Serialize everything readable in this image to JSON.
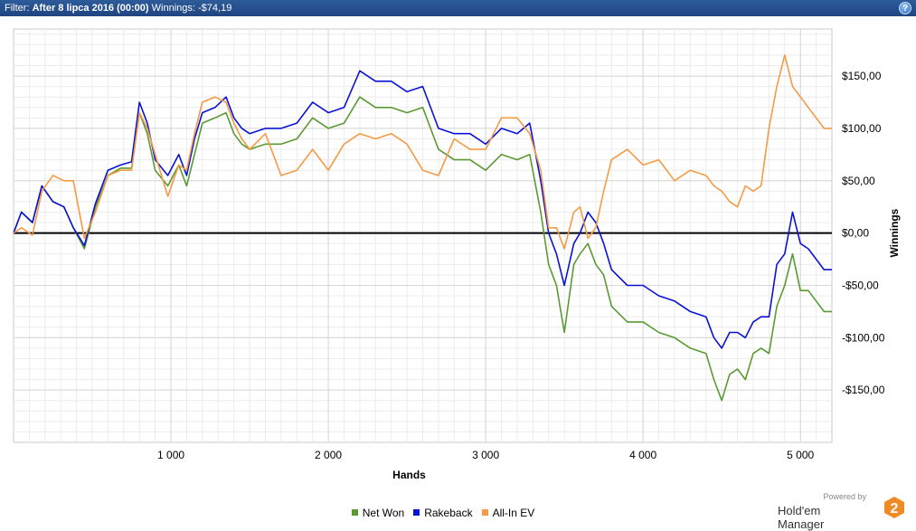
{
  "header": {
    "filter_label": "Filter:",
    "filter_value": "After 8 lipca 2016 (00:00)",
    "winnings_label": "Winnings:",
    "winnings_value": "-$74,19",
    "help_glyph": "?"
  },
  "brand": {
    "powered_by": "Powered by",
    "name": "Hold'em Manager",
    "logo_glyph": "2",
    "logo_color": "#f08a24"
  },
  "chart_data": {
    "type": "line",
    "xlabel": "Hands",
    "ylabel": "Winnings",
    "xlim": [
      0,
      5200
    ],
    "ylim": [
      -200,
      195
    ],
    "x_ticks": [
      1000,
      2000,
      3000,
      4000,
      5000
    ],
    "x_tick_labels": [
      "1 000",
      "2 000",
      "3 000",
      "4 000",
      "5 000"
    ],
    "y_ticks": [
      150,
      100,
      50,
      0,
      -50,
      -100,
      -150
    ],
    "y_tick_labels": [
      "$150,00",
      "$100,00",
      "$50,00",
      "$0,00",
      "-$50,00",
      "-$100,00",
      "-$150,00"
    ],
    "grid": true,
    "legend_position": "bottom-center",
    "series": [
      {
        "name": "Net Won",
        "color": "#5a9a32",
        "points": [
          [
            0,
            0
          ],
          [
            50,
            20
          ],
          [
            120,
            10
          ],
          [
            180,
            45
          ],
          [
            250,
            30
          ],
          [
            320,
            25
          ],
          [
            380,
            5
          ],
          [
            450,
            -15
          ],
          [
            520,
            25
          ],
          [
            600,
            55
          ],
          [
            680,
            62
          ],
          [
            750,
            62
          ],
          [
            800,
            115
          ],
          [
            850,
            95
          ],
          [
            900,
            60
          ],
          [
            980,
            45
          ],
          [
            1050,
            65
          ],
          [
            1100,
            45
          ],
          [
            1150,
            75
          ],
          [
            1200,
            105
          ],
          [
            1280,
            110
          ],
          [
            1350,
            115
          ],
          [
            1400,
            95
          ],
          [
            1450,
            85
          ],
          [
            1500,
            80
          ],
          [
            1600,
            85
          ],
          [
            1700,
            85
          ],
          [
            1800,
            90
          ],
          [
            1900,
            110
          ],
          [
            2000,
            100
          ],
          [
            2100,
            105
          ],
          [
            2200,
            130
          ],
          [
            2300,
            120
          ],
          [
            2400,
            120
          ],
          [
            2500,
            115
          ],
          [
            2600,
            120
          ],
          [
            2700,
            80
          ],
          [
            2800,
            70
          ],
          [
            2900,
            70
          ],
          [
            3000,
            60
          ],
          [
            3100,
            75
          ],
          [
            3200,
            70
          ],
          [
            3280,
            75
          ],
          [
            3350,
            20
          ],
          [
            3400,
            -30
          ],
          [
            3450,
            -50
          ],
          [
            3500,
            -95
          ],
          [
            3560,
            -30
          ],
          [
            3600,
            -20
          ],
          [
            3650,
            -10
          ],
          [
            3700,
            -30
          ],
          [
            3750,
            -40
          ],
          [
            3800,
            -70
          ],
          [
            3900,
            -85
          ],
          [
            4000,
            -85
          ],
          [
            4100,
            -95
          ],
          [
            4200,
            -100
          ],
          [
            4300,
            -110
          ],
          [
            4400,
            -115
          ],
          [
            4450,
            -140
          ],
          [
            4500,
            -160
          ],
          [
            4550,
            -135
          ],
          [
            4600,
            -130
          ],
          [
            4650,
            -140
          ],
          [
            4700,
            -115
          ],
          [
            4750,
            -110
          ],
          [
            4800,
            -115
          ],
          [
            4850,
            -70
          ],
          [
            4900,
            -50
          ],
          [
            4950,
            -20
          ],
          [
            5000,
            -55
          ],
          [
            5050,
            -55
          ],
          [
            5100,
            -65
          ],
          [
            5150,
            -75
          ],
          [
            5200,
            -75
          ]
        ]
      },
      {
        "name": "Rakeback",
        "color": "#0a12d6",
        "points": [
          [
            0,
            0
          ],
          [
            50,
            20
          ],
          [
            120,
            10
          ],
          [
            180,
            45
          ],
          [
            250,
            30
          ],
          [
            320,
            25
          ],
          [
            380,
            5
          ],
          [
            450,
            -12
          ],
          [
            520,
            28
          ],
          [
            600,
            60
          ],
          [
            680,
            65
          ],
          [
            750,
            68
          ],
          [
            800,
            125
          ],
          [
            850,
            105
          ],
          [
            900,
            70
          ],
          [
            980,
            55
          ],
          [
            1050,
            75
          ],
          [
            1100,
            55
          ],
          [
            1150,
            90
          ],
          [
            1200,
            115
          ],
          [
            1280,
            120
          ],
          [
            1350,
            130
          ],
          [
            1400,
            110
          ],
          [
            1450,
            100
          ],
          [
            1500,
            95
          ],
          [
            1600,
            100
          ],
          [
            1700,
            100
          ],
          [
            1800,
            105
          ],
          [
            1900,
            125
          ],
          [
            2000,
            115
          ],
          [
            2100,
            120
          ],
          [
            2200,
            155
          ],
          [
            2300,
            145
          ],
          [
            2400,
            145
          ],
          [
            2500,
            135
          ],
          [
            2600,
            140
          ],
          [
            2700,
            100
          ],
          [
            2800,
            95
          ],
          [
            2900,
            95
          ],
          [
            3000,
            85
          ],
          [
            3100,
            100
          ],
          [
            3200,
            95
          ],
          [
            3280,
            105
          ],
          [
            3350,
            50
          ],
          [
            3400,
            0
          ],
          [
            3450,
            -20
          ],
          [
            3500,
            -50
          ],
          [
            3560,
            -10
          ],
          [
            3600,
            0
          ],
          [
            3650,
            20
          ],
          [
            3700,
            10
          ],
          [
            3750,
            -10
          ],
          [
            3800,
            -35
          ],
          [
            3900,
            -50
          ],
          [
            4000,
            -50
          ],
          [
            4100,
            -60
          ],
          [
            4200,
            -65
          ],
          [
            4300,
            -75
          ],
          [
            4400,
            -80
          ],
          [
            4450,
            -100
          ],
          [
            4500,
            -110
          ],
          [
            4550,
            -95
          ],
          [
            4600,
            -95
          ],
          [
            4650,
            -100
          ],
          [
            4700,
            -85
          ],
          [
            4750,
            -80
          ],
          [
            4800,
            -80
          ],
          [
            4850,
            -30
          ],
          [
            4900,
            -20
          ],
          [
            4950,
            20
          ],
          [
            5000,
            -10
          ],
          [
            5050,
            -15
          ],
          [
            5100,
            -25
          ],
          [
            5150,
            -35
          ],
          [
            5200,
            -35
          ]
        ]
      },
      {
        "name": "All-In EV",
        "color": "#f59a45",
        "points": [
          [
            0,
            0
          ],
          [
            50,
            5
          ],
          [
            120,
            -2
          ],
          [
            180,
            40
          ],
          [
            250,
            55
          ],
          [
            320,
            50
          ],
          [
            380,
            50
          ],
          [
            450,
            -5
          ],
          [
            520,
            20
          ],
          [
            600,
            55
          ],
          [
            680,
            60
          ],
          [
            750,
            60
          ],
          [
            800,
            115
          ],
          [
            850,
            100
          ],
          [
            900,
            75
          ],
          [
            980,
            35
          ],
          [
            1050,
            65
          ],
          [
            1100,
            60
          ],
          [
            1150,
            95
          ],
          [
            1200,
            125
          ],
          [
            1280,
            130
          ],
          [
            1350,
            125
          ],
          [
            1400,
            105
          ],
          [
            1450,
            90
          ],
          [
            1500,
            80
          ],
          [
            1600,
            95
          ],
          [
            1700,
            55
          ],
          [
            1800,
            60
          ],
          [
            1900,
            80
          ],
          [
            2000,
            60
          ],
          [
            2100,
            85
          ],
          [
            2200,
            95
          ],
          [
            2300,
            90
          ],
          [
            2400,
            95
          ],
          [
            2500,
            85
          ],
          [
            2600,
            60
          ],
          [
            2700,
            55
          ],
          [
            2800,
            90
          ],
          [
            2900,
            80
          ],
          [
            3000,
            80
          ],
          [
            3100,
            110
          ],
          [
            3200,
            110
          ],
          [
            3280,
            95
          ],
          [
            3350,
            60
          ],
          [
            3400,
            5
          ],
          [
            3450,
            5
          ],
          [
            3500,
            -15
          ],
          [
            3560,
            20
          ],
          [
            3600,
            25
          ],
          [
            3650,
            -5
          ],
          [
            3700,
            5
          ],
          [
            3750,
            40
          ],
          [
            3800,
            70
          ],
          [
            3900,
            80
          ],
          [
            4000,
            65
          ],
          [
            4100,
            70
          ],
          [
            4200,
            50
          ],
          [
            4300,
            60
          ],
          [
            4400,
            55
          ],
          [
            4450,
            45
          ],
          [
            4500,
            40
          ],
          [
            4550,
            30
          ],
          [
            4600,
            25
          ],
          [
            4650,
            45
          ],
          [
            4700,
            40
          ],
          [
            4750,
            45
          ],
          [
            4800,
            100
          ],
          [
            4850,
            140
          ],
          [
            4900,
            170
          ],
          [
            4950,
            140
          ],
          [
            5000,
            130
          ],
          [
            5050,
            120
          ],
          [
            5100,
            110
          ],
          [
            5150,
            100
          ],
          [
            5200,
            100
          ]
        ]
      }
    ]
  }
}
